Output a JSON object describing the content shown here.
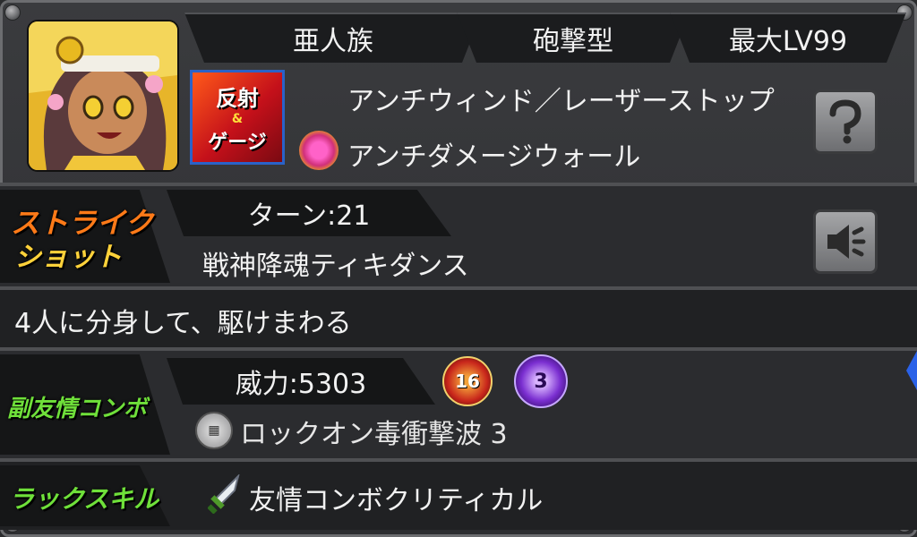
{
  "header": {
    "race": "亜人族",
    "type": "砲撃型",
    "max_level": "最大LV99"
  },
  "gimmick_badge": {
    "line1": "反射",
    "line2": "ゲージ",
    "mark": "&"
  },
  "abilities": {
    "line1": "アンチウィンド／レーザーストップ",
    "line2": "アンチダメージウォール"
  },
  "strike_shot": {
    "label_line1": "ストライク",
    "label_line2": "ショット",
    "turn": "ターン:21",
    "name": "戦神降魂ティキダンス",
    "description": "4人に分身して、駆けまわる"
  },
  "sub_friendship": {
    "label": "副友情コンボ",
    "power": "威力:5303",
    "name": "ロックオン毒衝撃波 3",
    "badge_red": "16",
    "badge_purple": "3"
  },
  "luck_skill": {
    "label": "ラックスキル",
    "name": "友情コンボクリティカル"
  },
  "colors": {
    "strike_label_top": "#ff7a18",
    "strike_label_bottom": "#ffd23a",
    "green_label": "#6fe03a",
    "red_badge": "#c8261b",
    "purple_badge": "#7a2ed0"
  }
}
